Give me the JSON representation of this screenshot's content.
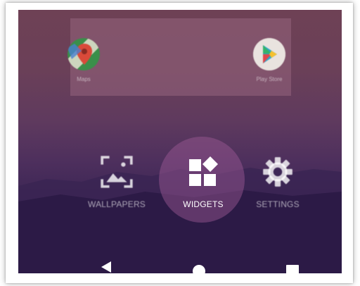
{
  "favorites": {
    "apps": [
      {
        "label": "Maps",
        "icon": "maps-icon"
      },
      {
        "label": "Play Store",
        "icon": "play-store-icon"
      }
    ]
  },
  "options": {
    "wallpapers": {
      "label": "WALLPAPERS",
      "icon": "wallpaper-icon"
    },
    "widgets": {
      "label": "WIDGETS",
      "icon": "widgets-icon"
    },
    "settings": {
      "label": "SETTINGS",
      "icon": "gear-icon"
    }
  },
  "navigation": {
    "back": {
      "icon": "back-icon"
    },
    "home": {
      "icon": "home-icon"
    },
    "recents": {
      "icon": "recents-icon"
    }
  },
  "colors": {
    "background_top": "#6e4155",
    "background_bottom": "#251840",
    "highlight": "#a05a96",
    "label_text": "#ffffff"
  }
}
